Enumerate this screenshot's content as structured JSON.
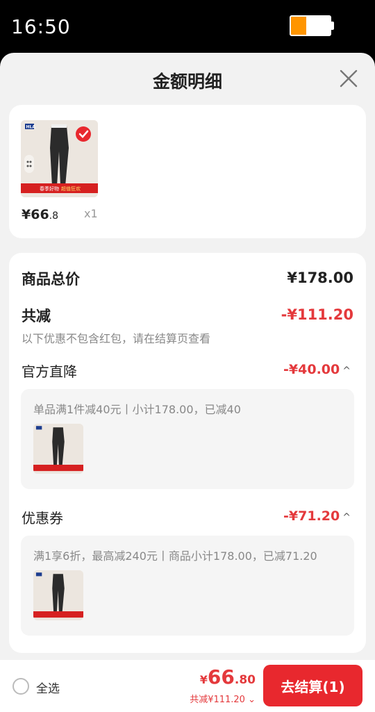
{
  "status": {
    "time": "16:50",
    "battery_level": 0.4,
    "battery_color": "#ff9500"
  },
  "sheet": {
    "title": "金额明细"
  },
  "product": {
    "price_int": "¥66",
    "price_dec": ".8",
    "quantity": "x1",
    "thumb_brand": "HLA",
    "thumb_banner_line1": "春季好物",
    "thumb_banner_line2": "超值狂欢"
  },
  "summary": {
    "total_label": "商品总价",
    "total_value": "¥178.00",
    "reduce_label": "共减",
    "reduce_value": "-¥111.20",
    "note": "以下优惠不包含红包，请在结算页查看"
  },
  "discounts": [
    {
      "label": "官方直降",
      "value": "-¥40.00",
      "chevron": "^",
      "detail": "单品满1件减40元丨小计178.00，已减40"
    },
    {
      "label": "优惠券",
      "value": "-¥71.20",
      "chevron": "^",
      "detail": "满1享6折，最高减240元丨商品小计178.00，已减71.20"
    }
  ],
  "footer": {
    "select_all": "全选",
    "price_symbol": "¥",
    "price_int": "66",
    "price_dec": ".80",
    "reduce_text": "共减¥111.20",
    "reduce_chevron": "⌄",
    "checkout_label": "去结算(1)"
  },
  "colors": {
    "accent": "#e4393c",
    "button": "#e8282e",
    "sheet_bg": "#f2f2f2"
  }
}
